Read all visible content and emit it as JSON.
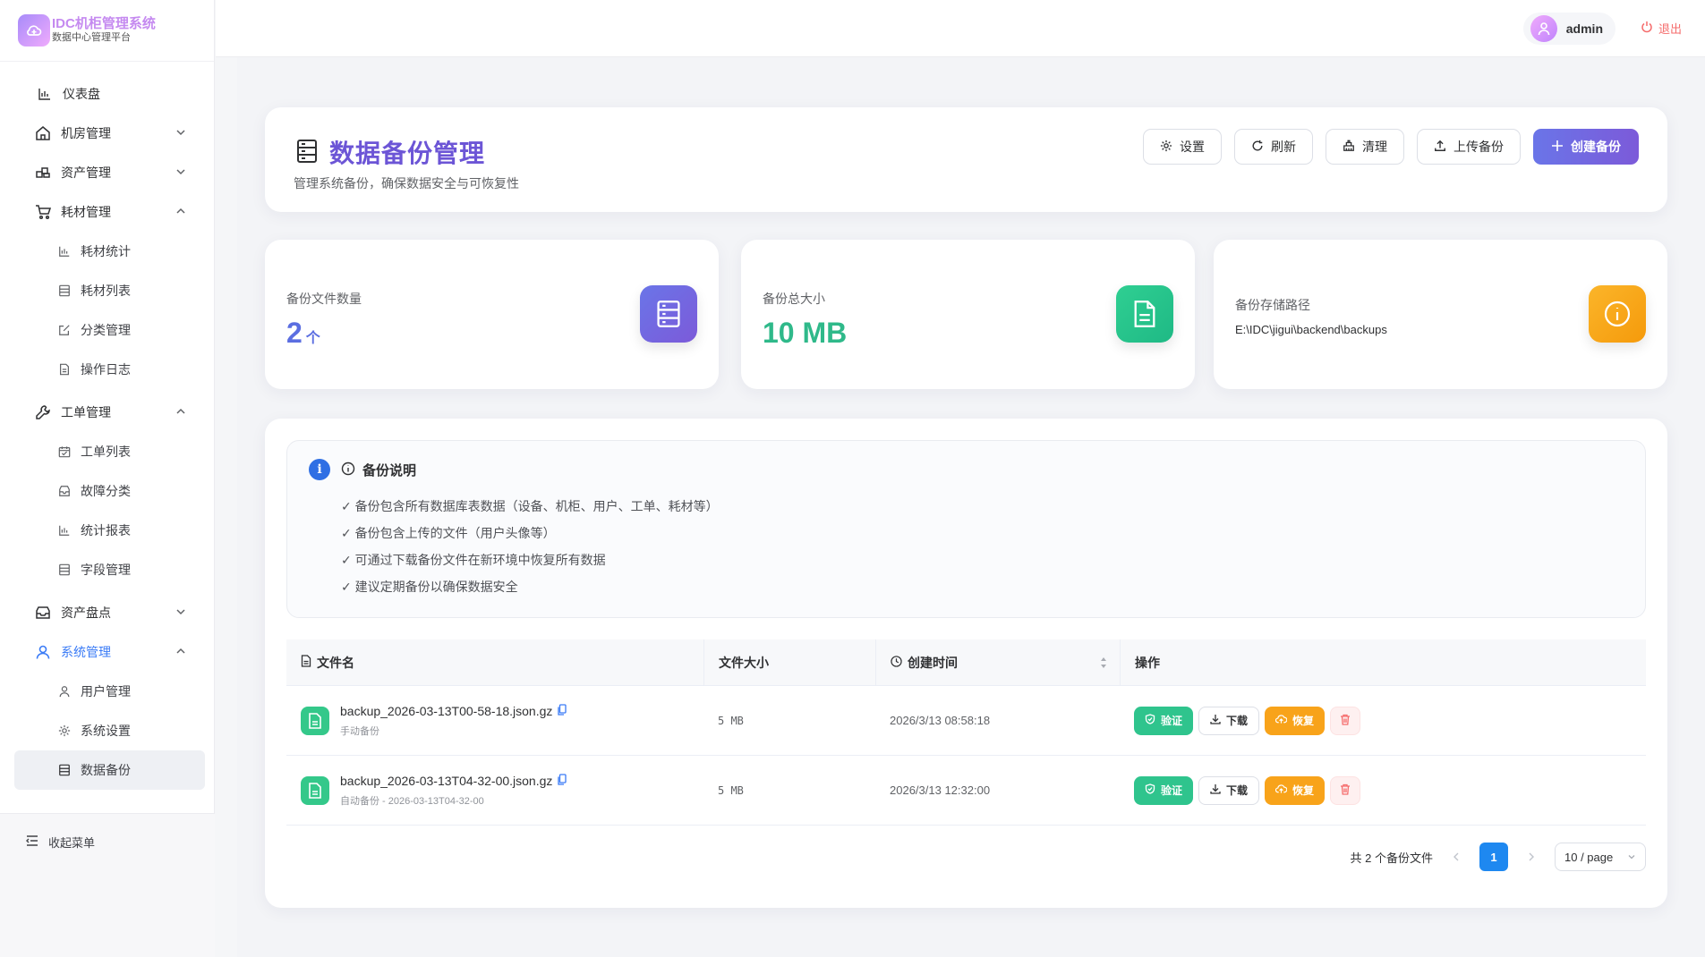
{
  "brand": {
    "title": "IDC机柜管理系统",
    "subtitle": "数据中心管理平台"
  },
  "sidebar": {
    "items": [
      {
        "label": "仪表盘"
      },
      {
        "label": "机房管理"
      },
      {
        "label": "资产管理"
      },
      {
        "label": "耗材管理",
        "children": [
          "耗材统计",
          "耗材列表",
          "分类管理",
          "操作日志"
        ]
      },
      {
        "label": "工单管理",
        "children": [
          "工单列表",
          "故障分类",
          "统计报表",
          "字段管理"
        ]
      },
      {
        "label": "资产盘点"
      },
      {
        "label": "系统管理",
        "children": [
          "用户管理",
          "系统设置",
          "数据备份"
        ]
      }
    ],
    "collapse_label": "收起菜单"
  },
  "header": {
    "user": "admin",
    "logout": "退出"
  },
  "page": {
    "title": "数据备份管理",
    "subtitle": "管理系统备份，确保数据安全与可恢复性",
    "toolbar": {
      "settings": "设置",
      "refresh": "刷新",
      "clean": "清理",
      "upload": "上传备份",
      "create": "创建备份"
    }
  },
  "stats": {
    "count": {
      "label": "备份文件数量",
      "value": "2",
      "unit": "个",
      "color": "#5b6ee1"
    },
    "size": {
      "label": "备份总大小",
      "value": "10 MB",
      "color": "#2fb98a"
    },
    "path": {
      "label": "备份存储路径",
      "value": "E:\\IDC\\jigui\\backend\\backups"
    }
  },
  "info": {
    "badge": "i",
    "title": "备份说明",
    "items": [
      "✓ 备份包含所有数据库表数据（设备、机柜、用户、工单、耗材等）",
      "✓ 备份包含上传的文件（用户头像等）",
      "✓ 可通过下载备份文件在新环境中恢复所有数据",
      "✓ 建议定期备份以确保数据安全"
    ]
  },
  "table": {
    "columns": [
      "文件名",
      "文件大小",
      "创建时间",
      "操作"
    ],
    "rows": [
      {
        "name": "backup_2026-03-13T00-58-18.json.gz",
        "desc": "手动备份",
        "size": "5 MB",
        "time": "2026/3/13 08:58:18"
      },
      {
        "name": "backup_2026-03-13T04-32-00.json.gz",
        "desc": "自动备份 - 2026-03-13T04-32-00",
        "size": "5 MB",
        "time": "2026/3/13 12:32:00"
      }
    ],
    "actions": {
      "verify": "验证",
      "download": "下载",
      "restore": "恢复"
    }
  },
  "pagination": {
    "total_text": "共 2 个备份文件",
    "current_page": "1",
    "page_size": "10 / page"
  }
}
